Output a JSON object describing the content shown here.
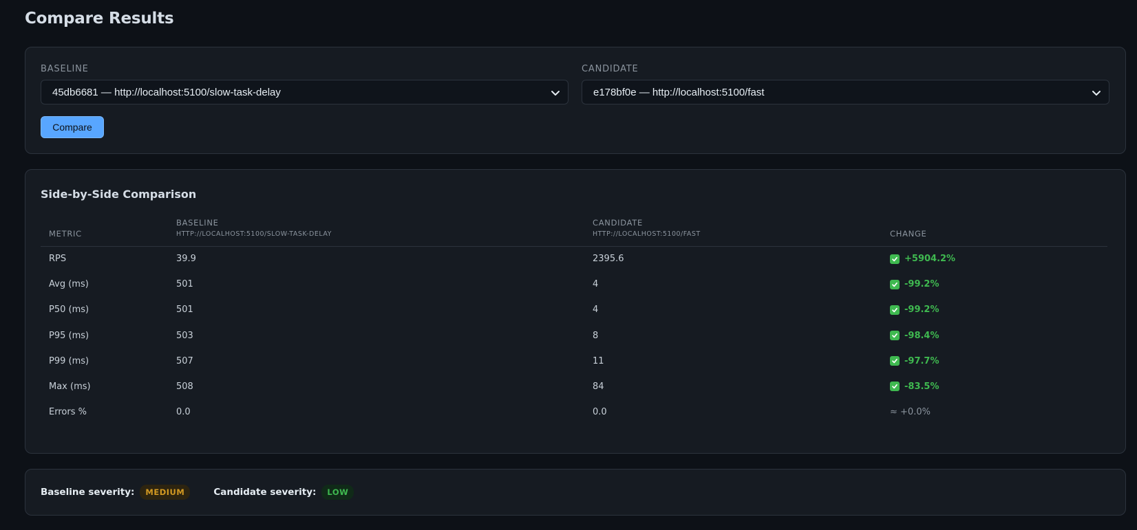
{
  "page": {
    "title": "Compare Results"
  },
  "selectors": {
    "baseline": {
      "label": "BASELINE",
      "value": "45db6681 — http://localhost:5100/slow-task-delay"
    },
    "candidate": {
      "label": "CANDIDATE",
      "value": "e178bf0e — http://localhost:5100/fast"
    },
    "compare_label": "Compare"
  },
  "comparison": {
    "title": "Side-by-Side Comparison",
    "headers": {
      "metric": "METRIC",
      "baseline": "BASELINE",
      "baseline_sub": "HTTP://LOCALHOST:5100/SLOW-TASK-DELAY",
      "candidate": "CANDIDATE",
      "candidate_sub": "HTTP://LOCALHOST:5100/FAST",
      "change": "CHANGE"
    },
    "rows": [
      {
        "metric": "RPS",
        "baseline": "39.9",
        "candidate": "2395.6",
        "change": "+5904.2%",
        "status": "good"
      },
      {
        "metric": "Avg (ms)",
        "baseline": "501",
        "candidate": "4",
        "change": "-99.2%",
        "status": "good"
      },
      {
        "metric": "P50 (ms)",
        "baseline": "501",
        "candidate": "4",
        "change": "-99.2%",
        "status": "good"
      },
      {
        "metric": "P95 (ms)",
        "baseline": "503",
        "candidate": "8",
        "change": "-98.4%",
        "status": "good"
      },
      {
        "metric": "P99 (ms)",
        "baseline": "507",
        "candidate": "11",
        "change": "-97.7%",
        "status": "good"
      },
      {
        "metric": "Max (ms)",
        "baseline": "508",
        "candidate": "84",
        "change": "-83.5%",
        "status": "good"
      },
      {
        "metric": "Errors %",
        "baseline": "0.0",
        "candidate": "0.0",
        "change": "≈ +0.0%",
        "status": "neutral"
      }
    ]
  },
  "severity": {
    "baseline_label": "Baseline severity:",
    "baseline_value": "MEDIUM",
    "candidate_label": "Candidate severity:",
    "candidate_value": "LOW"
  },
  "colors": {
    "background": "#0d1117",
    "card": "#161b22",
    "accent": "#58a6ff",
    "good": "#3fb950",
    "medium": "#d29922"
  },
  "icons": {
    "select": "chevron-down-icon",
    "improved": "check-box-icon"
  }
}
